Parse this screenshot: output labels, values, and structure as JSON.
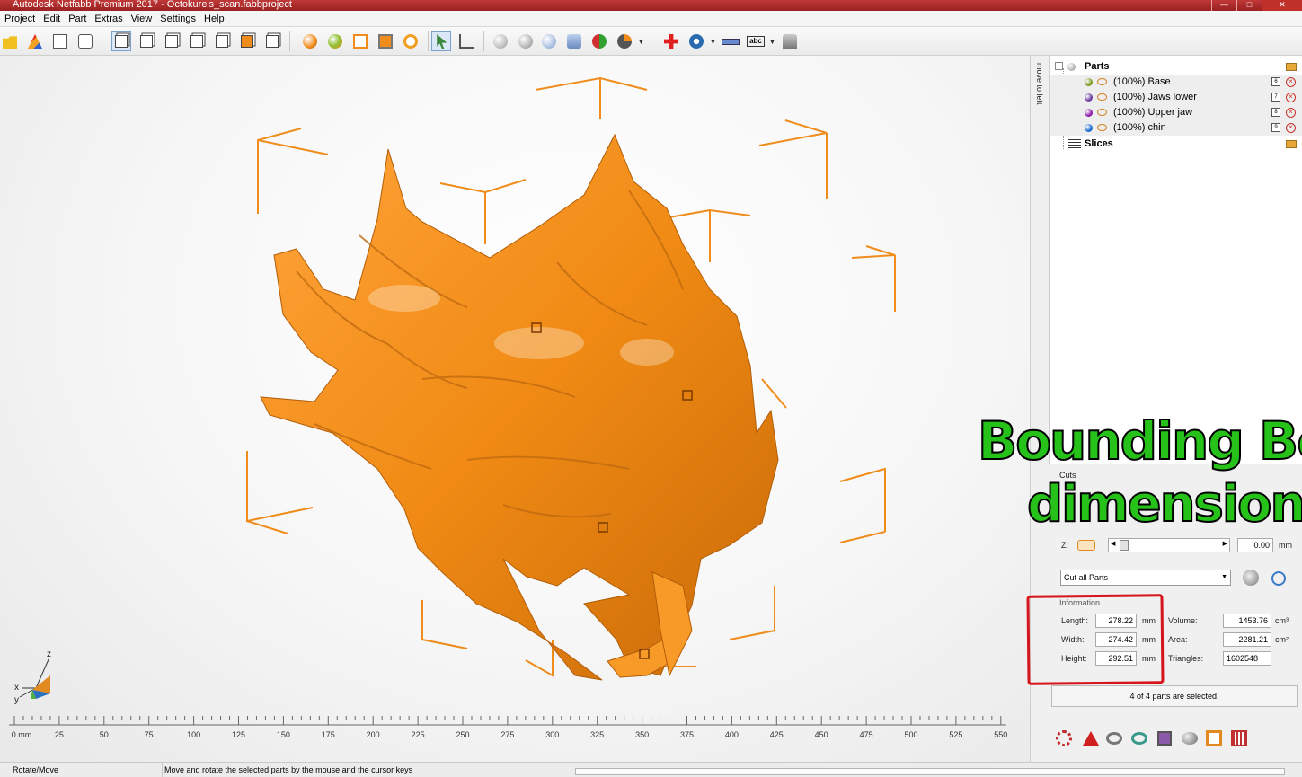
{
  "window": {
    "title": "Autodesk Netfabb Premium 2017 - Octokure's_scan.fabbproject"
  },
  "menu": [
    "Project",
    "Edit",
    "Part",
    "Extras",
    "View",
    "Settings",
    "Help"
  ],
  "toolbar_icons": [
    "open-icon",
    "add-part-icon",
    "repair-icon",
    "add-icon",
    "view-front-icon",
    "view-back-icon",
    "view-left-icon",
    "view-right-icon",
    "view-top-icon",
    "view-bottom-icon",
    "view-iso-icon",
    "shading-icon",
    "colors-icon",
    "wireframe-icon",
    "section-icon",
    "zoom-icon",
    "select-icon",
    "measure-icon",
    "sphere-icon",
    "move-icon",
    "arrange-icon",
    "scale-icon",
    "texture-icon",
    "boolean-icon",
    "pie-icon",
    "add-red-icon",
    "camera-icon",
    "ruler-icon",
    "text-icon",
    "machine-icon"
  ],
  "overlay": {
    "line1": "Bounding Box",
    "line2": "dimensions",
    "color": "#26c21a"
  },
  "axes": {
    "z": "z",
    "x": "x",
    "y": "y"
  },
  "ruler": {
    "unit_label": "0 mm",
    "ticks": [
      "25",
      "50",
      "75",
      "100",
      "125",
      "150",
      "175",
      "200",
      "225",
      "250",
      "275",
      "300",
      "325",
      "350",
      "375",
      "400",
      "425",
      "450",
      "475",
      "500",
      "525",
      "550"
    ]
  },
  "sidebar": {
    "move_to_left": "move to left"
  },
  "tree": {
    "parts_label": "Parts",
    "items": [
      {
        "label": "(100%) Base",
        "dot_color": "#7a9a22",
        "num": "6"
      },
      {
        "label": "(100%) Jaws lower",
        "dot_color": "#6a3aa0",
        "num": "7"
      },
      {
        "label": "(100%) Upper jaw",
        "dot_color": "#8a1aa8",
        "num": "8"
      },
      {
        "label": "(100%) chin",
        "dot_color": "#1a6ad0",
        "num": "9"
      }
    ],
    "slices_label": "Slices"
  },
  "cuts": {
    "title": "Cuts",
    "z_label": "Z:",
    "z_value": "0.00",
    "z_unit": "mm",
    "mode": "Cut all Parts"
  },
  "information": {
    "title": "Information",
    "length_label": "Length:",
    "length": "278.22",
    "width_label": "Width:",
    "width": "274.42",
    "height_label": "Height:",
    "height": "292.51",
    "dim_unit": "mm",
    "volume_label": "Volume:",
    "volume": "1453.76",
    "volume_unit": "cm³",
    "area_label": "Area:",
    "area": "2281.21",
    "area_unit": "cm²",
    "triangles_label": "Triangles:",
    "triangles": "1602548"
  },
  "selection_status": "4 of 4 parts are selected.",
  "status": {
    "mode": "Rotate/Move",
    "hint": "Move and rotate the selected parts by the mouse and the cursor keys"
  }
}
